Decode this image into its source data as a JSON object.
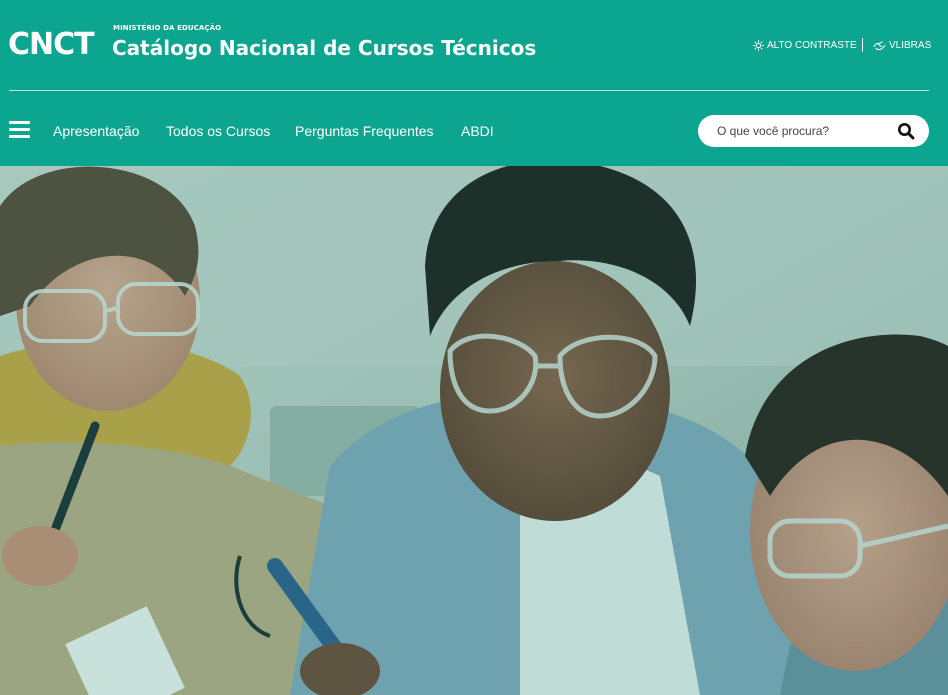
{
  "header": {
    "logo": "CNCT",
    "ministry": "MINISTÉRIO DA EDUCAÇÃO",
    "title": "Catálogo Nacional de Cursos Técnicos",
    "background_color": "#0ca58f",
    "utilities": {
      "contrast_label": "ALTO CONTRASTE",
      "contrast_icon": "sun-icon",
      "libras_label": "VLIBRAS",
      "libras_icon": "hand-sign-icon"
    }
  },
  "nav": {
    "menu_icon": "hamburger-menu-icon",
    "items": [
      "Apresentação",
      "Todos os Cursos",
      "Perguntas Frequentes",
      "ABDI"
    ]
  },
  "search": {
    "placeholder": "O que você procura?",
    "value": "",
    "icon": "search-icon"
  },
  "hero": {
    "image": "students-with-safety-glasses-photo",
    "overlay_color": "#1a9a86"
  }
}
